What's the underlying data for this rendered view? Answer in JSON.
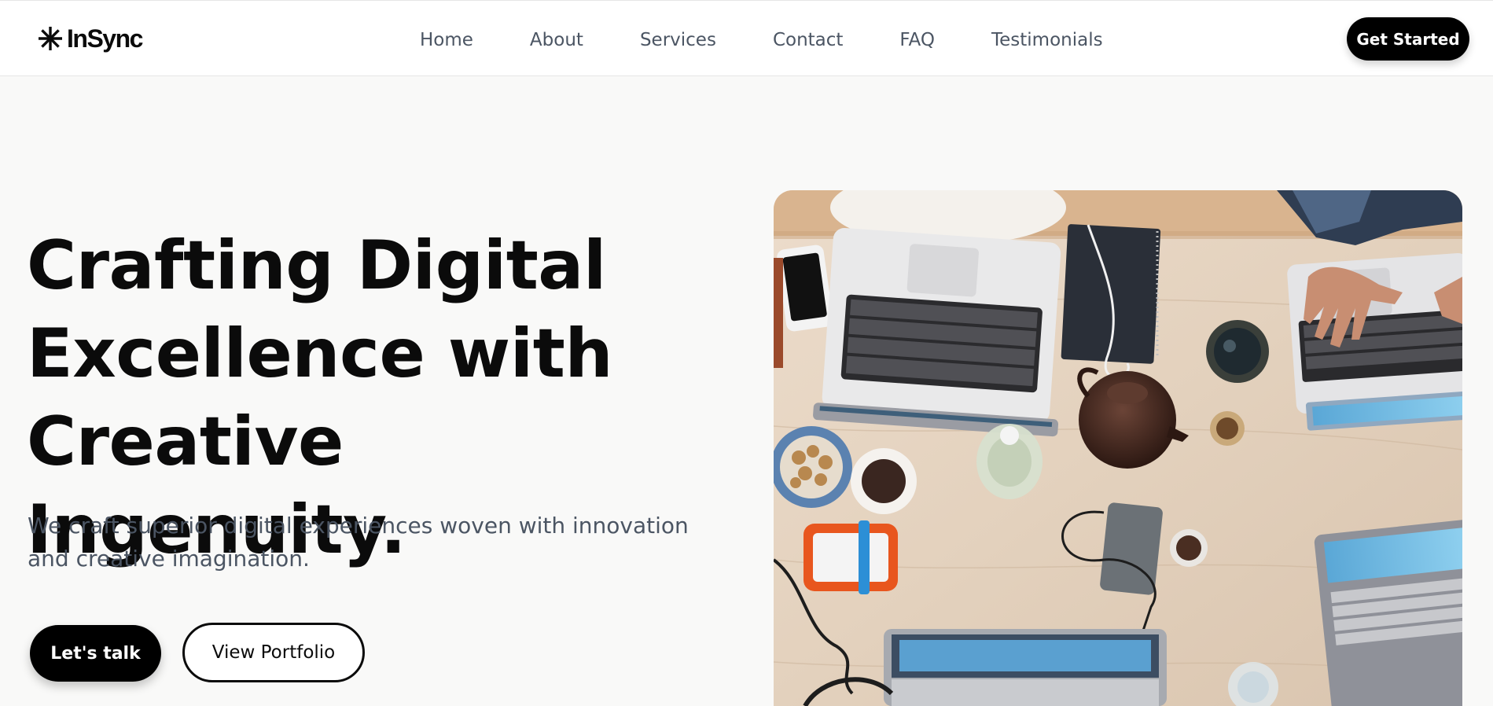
{
  "brand": {
    "name": "InSync",
    "logo_icon": "asterisk-icon"
  },
  "nav": {
    "links": [
      {
        "label": "Home"
      },
      {
        "label": "About"
      },
      {
        "label": "Services"
      },
      {
        "label": "Contact"
      },
      {
        "label": "FAQ"
      },
      {
        "label": "Testimonials"
      }
    ],
    "cta_label": "Get Started"
  },
  "hero": {
    "title_lines": [
      "Crafting Digital",
      "Excellence with",
      "Creative Ingenuity."
    ],
    "subtitle": "We craft superior digital experiences woven with innovation and creative imagination.",
    "primary_cta": "Let's talk",
    "secondary_cta": "View Portfolio",
    "image_subject": "overhead-workspace-photo"
  },
  "colors": {
    "page_background": "#f9f9f8",
    "header_background": "#ffffff",
    "primary": "#000000",
    "nav_text": "#4b5563",
    "body_text": "#4b5563",
    "heading_text": "#0b0b0b"
  }
}
